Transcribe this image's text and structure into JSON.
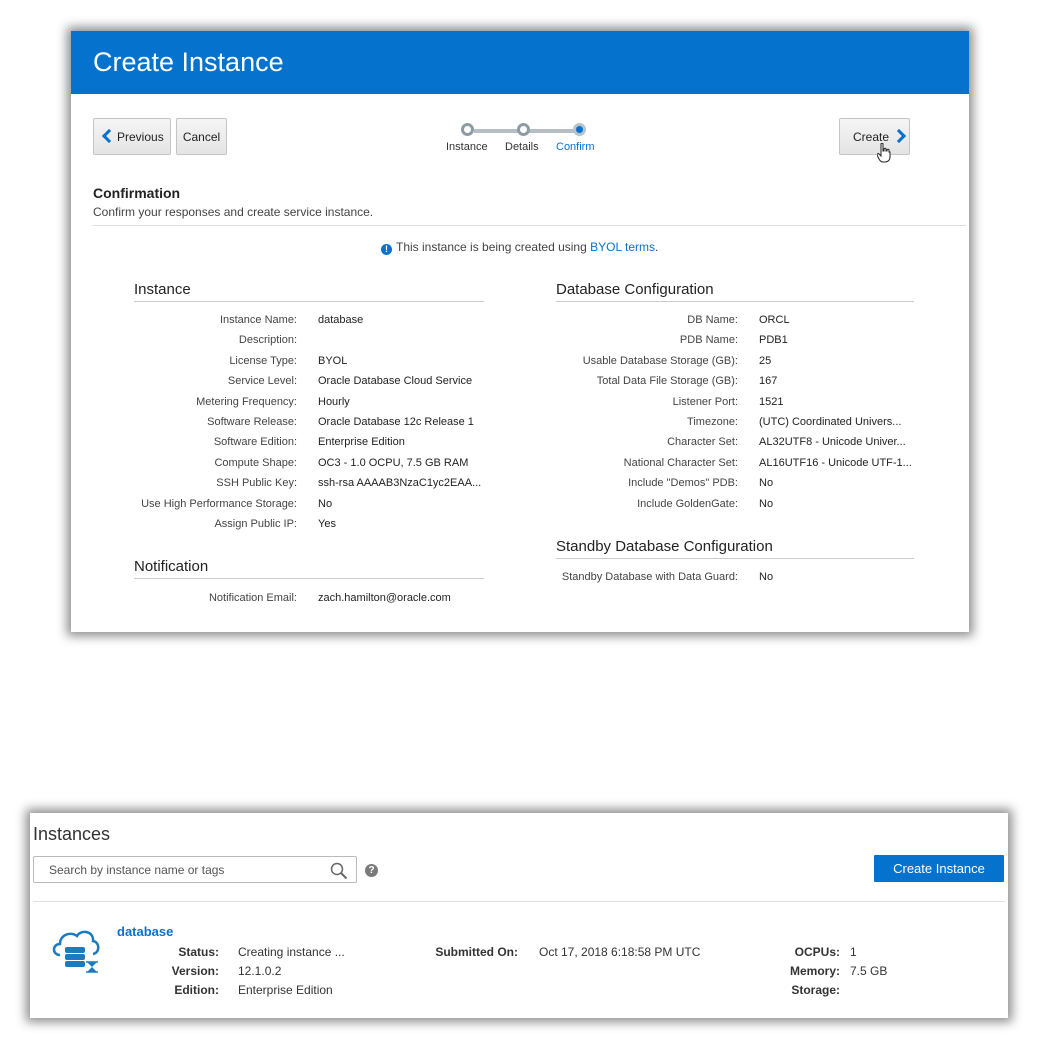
{
  "wizard": {
    "title": "Create Instance",
    "previous_label": "Previous",
    "cancel_label": "Cancel",
    "create_label": "Create",
    "steps": [
      {
        "label": "Instance",
        "state": "visited"
      },
      {
        "label": "Details",
        "state": "visited"
      },
      {
        "label": "Confirm",
        "state": "current"
      }
    ],
    "confirmation": {
      "title": "Confirmation",
      "description": "Confirm your responses and create service instance.",
      "notice_text": "This instance is being created using ",
      "notice_link": "BYOL terms",
      "notice_end": "."
    },
    "instance_section": {
      "heading": "Instance",
      "fields": [
        {
          "label": "Instance Name:",
          "value": "database"
        },
        {
          "label": "Description:",
          "value": ""
        },
        {
          "label": "License Type:",
          "value": "BYOL"
        },
        {
          "label": "Service Level:",
          "value": "Oracle Database Cloud Service"
        },
        {
          "label": "Metering Frequency:",
          "value": "Hourly"
        },
        {
          "label": "Software Release:",
          "value": "Oracle Database 12c Release 1"
        },
        {
          "label": "Software Edition:",
          "value": "Enterprise Edition"
        },
        {
          "label": "Compute Shape:",
          "value": "OC3 - 1.0 OCPU, 7.5 GB RAM"
        },
        {
          "label": "SSH Public Key:",
          "value": "ssh-rsa AAAAB3NzaC1yc2EAA..."
        },
        {
          "label": "Use High Performance Storage:",
          "value": "No"
        },
        {
          "label": "Assign Public IP:",
          "value": "Yes"
        }
      ]
    },
    "notification_section": {
      "heading": "Notification",
      "fields": [
        {
          "label": "Notification Email:",
          "value": "zach.hamilton@oracle.com"
        }
      ]
    },
    "database_section": {
      "heading": "Database Configuration",
      "fields": [
        {
          "label": "DB Name:",
          "value": "ORCL"
        },
        {
          "label": "PDB Name:",
          "value": "PDB1"
        },
        {
          "label": "Usable Database Storage (GB):",
          "value": "25"
        },
        {
          "label": "Total Data File Storage (GB):",
          "value": "167"
        },
        {
          "label": "Listener Port:",
          "value": "1521"
        },
        {
          "label": "Timezone:",
          "value": "(UTC) Coordinated Univers..."
        },
        {
          "label": "Character Set:",
          "value": "AL32UTF8 - Unicode Univer..."
        },
        {
          "label": "National Character Set:",
          "value": "AL16UTF16 - Unicode UTF-1..."
        },
        {
          "label": "Include \"Demos\" PDB:",
          "value": "No"
        },
        {
          "label": "Include GoldenGate:",
          "value": "No"
        }
      ]
    },
    "standby_section": {
      "heading": "Standby Database Configuration",
      "fields": [
        {
          "label": "Standby Database with Data Guard:",
          "value": "No"
        }
      ]
    }
  },
  "instances": {
    "title": "Instances",
    "search_placeholder": "Search by instance name or tags",
    "help_glyph": "?",
    "create_button_label": "Create Instance",
    "item": {
      "name": "database",
      "status_label": "Status:",
      "status_value": "Creating instance ...",
      "version_label": "Version:",
      "version_value": "12.1.0.2",
      "edition_label": "Edition:",
      "edition_value": "Enterprise Edition",
      "submitted_label": "Submitted On:",
      "submitted_value": "Oct 17, 2018 6:18:58 PM UTC",
      "ocpus_label": "OCPUs:",
      "ocpus_value": "1",
      "memory_label": "Memory:",
      "memory_value": "7.5 GB",
      "storage_label": "Storage:",
      "storage_value": ""
    }
  },
  "colors": {
    "accent": "#0572ce",
    "header_text": "#ffffff"
  },
  "icons": [
    "chevron-left-icon",
    "chevron-right-icon",
    "hand-cursor-icon",
    "info-icon",
    "search-icon",
    "help-icon",
    "database-cloud-icon"
  ]
}
